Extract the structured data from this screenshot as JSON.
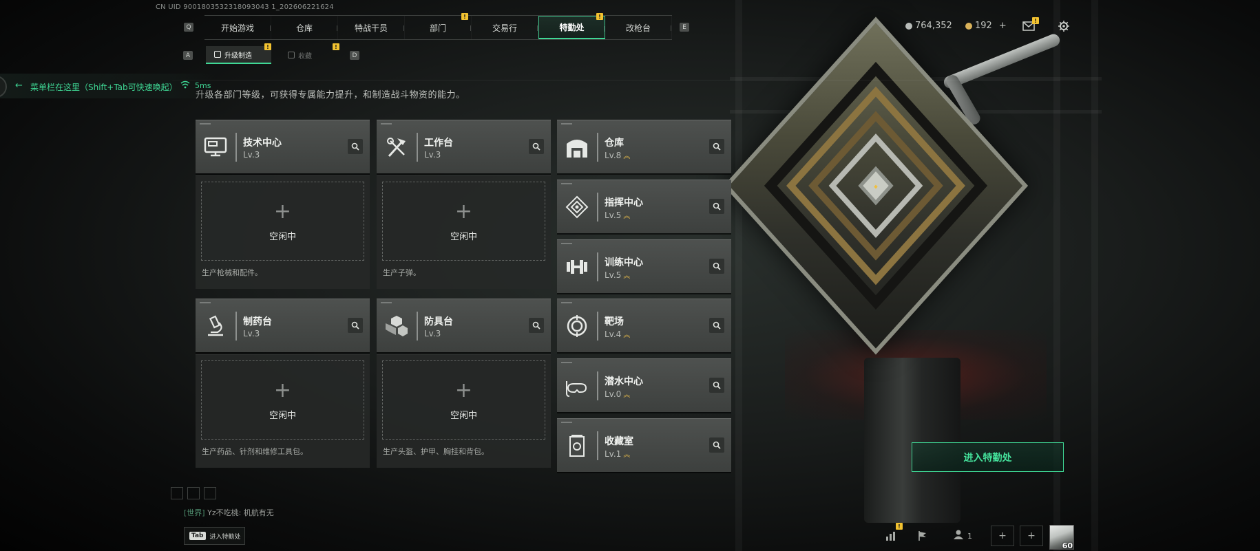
{
  "uid_text": "CN UID 9001803532318093043 1_202606221624",
  "nav": {
    "key_left": "Q",
    "key_right": "E",
    "tabs": [
      {
        "label": "开始游戏",
        "badge": ""
      },
      {
        "label": "仓库",
        "badge": ""
      },
      {
        "label": "特战干员",
        "badge": ""
      },
      {
        "label": "部门",
        "badge": "!"
      },
      {
        "label": "交易行",
        "badge": ""
      },
      {
        "label": "特勤处",
        "badge": "!",
        "active": true
      },
      {
        "label": "改枪台",
        "badge": ""
      }
    ]
  },
  "subnav": {
    "key_left": "A",
    "key_right": "D",
    "tabs": [
      {
        "label": "升级制造",
        "badge": "!",
        "active": true
      },
      {
        "label": "收藏",
        "badge": "!"
      }
    ]
  },
  "tip": {
    "text": "菜单栏在这里（Shift+Tab可快速唤起）",
    "ping": "5ms"
  },
  "description": "升级各部门等级，可获得专属能力提升，和制造战斗物资的能力。",
  "facilities": {
    "tech_center": {
      "name": "技术中心",
      "level": "Lv.3",
      "icon": "monitor-icon"
    },
    "workbench": {
      "name": "工作台",
      "level": "Lv.3",
      "icon": "tools-icon"
    },
    "pharmacy": {
      "name": "制药台",
      "level": "Lv.3",
      "icon": "microscope-icon"
    },
    "armor_bench": {
      "name": "防具台",
      "level": "Lv.3",
      "icon": "cubes-icon"
    },
    "warehouse": {
      "name": "仓库",
      "level": "Lv.8",
      "icon": "warehouse-icon"
    },
    "command_center": {
      "name": "指挥中心",
      "level": "Lv.5",
      "icon": "target-icon"
    },
    "training_center": {
      "name": "训练中心",
      "level": "Lv.5",
      "icon": "dumbbell-icon"
    },
    "range": {
      "name": "靶场",
      "level": "Lv.4",
      "icon": "bullseye-icon"
    },
    "diving_center": {
      "name": "潜水中心",
      "level": "Lv.0",
      "icon": "snorkel-icon"
    },
    "collection_room": {
      "name": "收藏室",
      "level": "Lv.1",
      "icon": "trophy-icon"
    }
  },
  "slots": {
    "tech_center": {
      "plus": "+",
      "state": "空闲中",
      "desc": "生产枪械和配件。"
    },
    "workbench": {
      "plus": "+",
      "state": "空闲中",
      "desc": "生产子弹。"
    },
    "pharmacy": {
      "plus": "+",
      "state": "空闲中",
      "desc": "生产药品、针剂和维修工具包。"
    },
    "armor_bench": {
      "plus": "+",
      "state": "空闲中",
      "desc": "生产头盔、护甲、胸挂和背包。"
    }
  },
  "currency": {
    "silver": "764,352",
    "gold": "192",
    "add": "+",
    "silver_color": "#b8bcb9",
    "gold_color": "#d9b25a"
  },
  "enter_button": "进入特勤处",
  "chat": {
    "channel": "[世界]",
    "user": "Yz不吃桃:",
    "message": "机航有无"
  },
  "tab_hint": {
    "key": "Tab",
    "label": "进入特勤处"
  },
  "bottom_right": {
    "team_count": "1",
    "avatar_level": "60",
    "badge": "!"
  },
  "colors": {
    "accent": "#3fd895",
    "badge": "#f2c230",
    "card_bg": "#474a48"
  }
}
